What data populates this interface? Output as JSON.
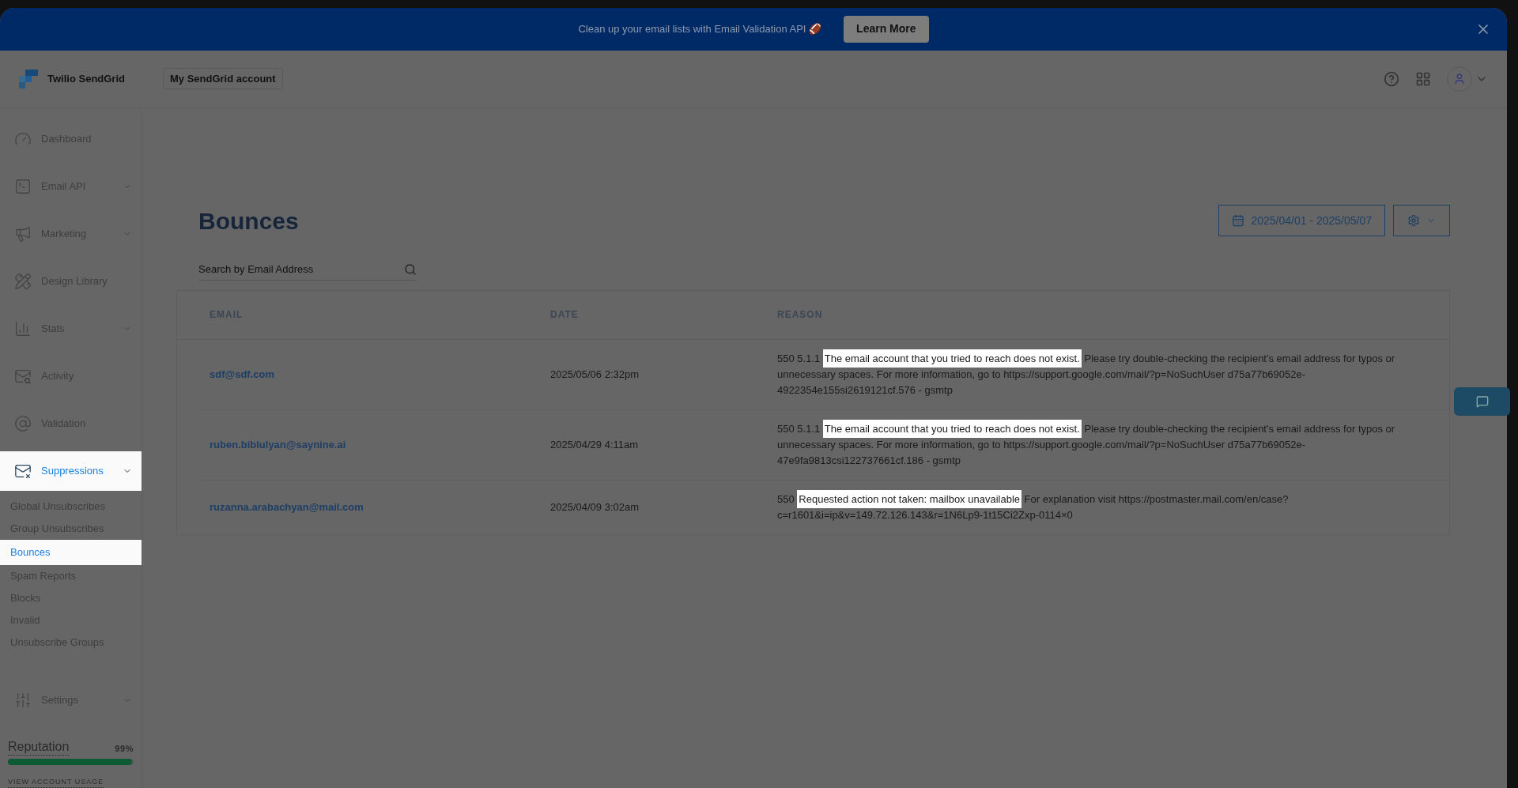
{
  "banner": {
    "text": "Clean up your email lists with Email Validation API 🏈",
    "button": "Learn More"
  },
  "header": {
    "brand": "Twilio SendGrid",
    "account": "My SendGrid account"
  },
  "sidebar": {
    "items": [
      {
        "label": "Dashboard",
        "expandable": false,
        "selected": false
      },
      {
        "label": "Email API",
        "expandable": true,
        "selected": false
      },
      {
        "label": "Marketing",
        "expandable": true,
        "selected": false
      },
      {
        "label": "Design Library",
        "expandable": false,
        "selected": false
      },
      {
        "label": "Stats",
        "expandable": true,
        "selected": false
      },
      {
        "label": "Activity",
        "expandable": false,
        "selected": false
      },
      {
        "label": "Validation",
        "expandable": false,
        "selected": false
      },
      {
        "label": "Suppressions",
        "expandable": true,
        "selected": true,
        "children": [
          {
            "label": "Global Unsubscribes",
            "selected": false
          },
          {
            "label": "Group Unsubscribes",
            "selected": false
          },
          {
            "label": "Bounces",
            "selected": true
          },
          {
            "label": "Spam Reports",
            "selected": false
          },
          {
            "label": "Blocks",
            "selected": false
          },
          {
            "label": "Invalid",
            "selected": false
          },
          {
            "label": "Unsubscribe Groups",
            "selected": false
          }
        ]
      },
      {
        "label": "Settings",
        "expandable": true,
        "selected": false
      }
    ],
    "reputation": {
      "label": "Reputation",
      "value": "99%",
      "level": 0.99
    },
    "usage_link": "VIEW ACCOUNT USAGE"
  },
  "page": {
    "title": "Bounces",
    "date_range": "2025/04/01 - 2025/05/07",
    "search": {
      "placeholder": "Search by Email Address"
    }
  },
  "table": {
    "columns": [
      "EMAIL",
      "DATE",
      "REASON"
    ],
    "rows": [
      {
        "email": "sdf@sdf.com",
        "date": "2025/05/06 2:32pm",
        "reason": [
          {
            "text": "550 5.1.1 ",
            "highlighted": false
          },
          {
            "text": "The email account that you tried to reach does not exist.",
            "highlighted": true
          },
          {
            "text": " Please try double-checking the recipient's email address for typos or unnecessary spaces. For more information, go to https://support.google.com/mail/?p=NoSuchUser d75a77b69052e-4922354e155si2619121cf.576 - gsmtp",
            "highlighted": false
          }
        ]
      },
      {
        "email": "ruben.biblulyan@saynine.ai",
        "date": "2025/04/29 4:11am",
        "reason": [
          {
            "text": "550 5.1.1 ",
            "highlighted": false
          },
          {
            "text": "The email account that you tried to reach does not exist.",
            "highlighted": true
          },
          {
            "text": " Please try double-checking the recipient's email address for typos or unnecessary spaces. For more information, go to https://support.google.com/mail/?p=NoSuchUser d75a77b69052e-47e9fa9813csi122737661cf.186 - gsmtp",
            "highlighted": false
          }
        ]
      },
      {
        "email": "ruzanna.arabachyan@mail.com",
        "date": "2025/04/09 3:02am",
        "reason": [
          {
            "text": "550 ",
            "highlighted": false
          },
          {
            "text": "Requested action not taken: mailbox unavailable",
            "highlighted": true
          },
          {
            "text": " For explanation visit https://postmaster.mail.com/en/case?c=r1601&i=ip&v=149.72.126.143&r=1N6Lp9-1t15Ci2Zxp-0114×0",
            "highlighted": false
          }
        ]
      }
    ]
  }
}
